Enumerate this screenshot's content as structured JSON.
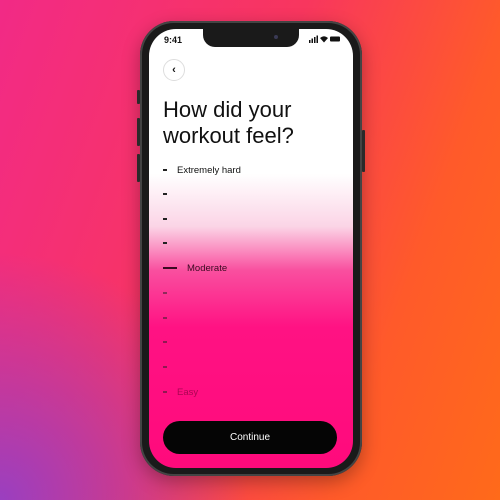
{
  "status_bar": {
    "time": "9:41",
    "icons": "signal-wifi-battery"
  },
  "back_label": "‹",
  "title": "How did your workout feel?",
  "scale": {
    "items": [
      {
        "label": "Extremely hard"
      },
      {
        "label": ""
      },
      {
        "label": ""
      },
      {
        "label": ""
      },
      {
        "label": "Moderate",
        "selected": true
      },
      {
        "label": ""
      },
      {
        "label": ""
      },
      {
        "label": ""
      },
      {
        "label": ""
      },
      {
        "label": "Easy"
      }
    ]
  },
  "continue_label": "Continue",
  "colors": {
    "accent": "#ff0a7c",
    "button": "#050505"
  }
}
